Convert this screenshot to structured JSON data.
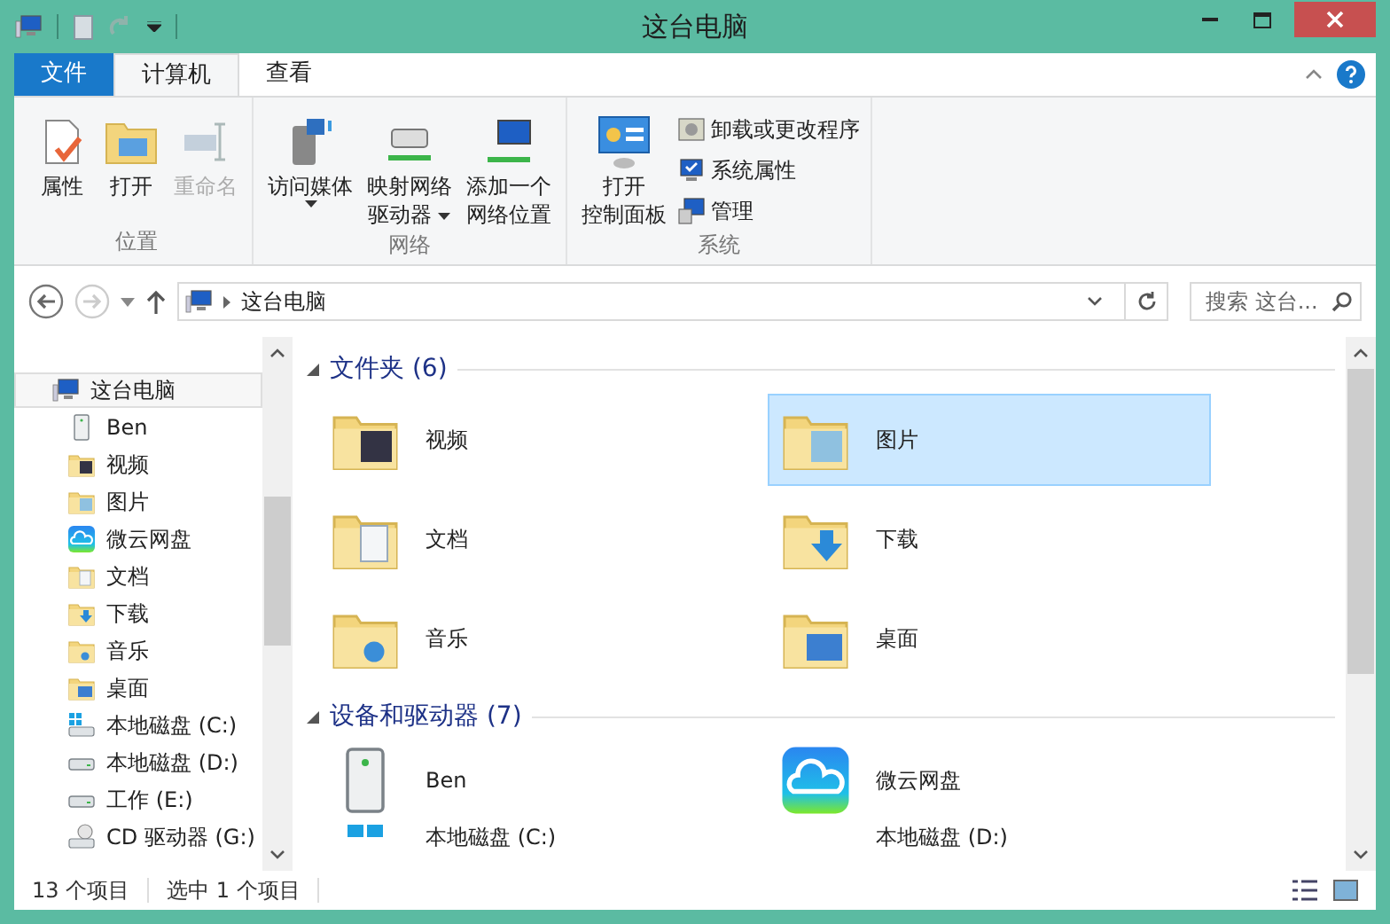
{
  "window": {
    "title": "这台电脑"
  },
  "tabs": [
    {
      "label": "文件",
      "kind": "file",
      "selected": false
    },
    {
      "label": "计算机",
      "kind": "tab",
      "selected": true
    },
    {
      "label": "查看",
      "kind": "tab",
      "selected": false
    }
  ],
  "ribbon": [
    {
      "label": "位置",
      "items": [
        {
          "kind": "large",
          "lines": [
            "属性"
          ],
          "disabled": false,
          "dropdown": false
        },
        {
          "kind": "large",
          "lines": [
            "打开"
          ],
          "disabled": false,
          "dropdown": false
        },
        {
          "kind": "large",
          "lines": [
            "重命名"
          ],
          "disabled": true,
          "dropdown": false
        }
      ]
    },
    {
      "label": "网络",
      "items": [
        {
          "kind": "large",
          "lines": [
            "访问媒体"
          ],
          "disabled": false,
          "dropdown": true
        },
        {
          "kind": "large",
          "lines": [
            "映射网络",
            "驱动器"
          ],
          "disabled": false,
          "dropdown": true
        },
        {
          "kind": "large",
          "lines": [
            "添加一个",
            "网络位置"
          ],
          "disabled": false,
          "dropdown": false
        }
      ]
    },
    {
      "label": "系统",
      "items": [
        {
          "kind": "large",
          "lines": [
            "打开",
            "控制面板"
          ],
          "disabled": false,
          "dropdown": false
        },
        {
          "kind": "small",
          "lines": [
            "卸载或更改程序"
          ],
          "disabled": false
        },
        {
          "kind": "small",
          "lines": [
            "系统属性"
          ],
          "disabled": false
        },
        {
          "kind": "small",
          "lines": [
            "管理"
          ],
          "disabled": false
        }
      ]
    }
  ],
  "address": {
    "path": "这台电脑"
  },
  "search": {
    "placeholder": "搜索 这台..."
  },
  "sidebar": {
    "items": [
      {
        "label": "这台电脑",
        "selected": true,
        "children": [
          {
            "label": "Ben",
            "selected": false
          },
          {
            "label": "视频",
            "selected": false
          },
          {
            "label": "图片",
            "selected": false
          },
          {
            "label": "微云网盘",
            "selected": false
          },
          {
            "label": "文档",
            "selected": false
          },
          {
            "label": "下载",
            "selected": false
          },
          {
            "label": "音乐",
            "selected": false
          },
          {
            "label": "桌面",
            "selected": false
          },
          {
            "label": "本地磁盘 (C:)",
            "selected": false
          },
          {
            "label": "本地磁盘 (D:)",
            "selected": false
          },
          {
            "label": "工作 (E:)",
            "selected": false
          },
          {
            "label": "CD 驱动器 (G:)",
            "selected": false
          }
        ]
      }
    ]
  },
  "groups": [
    {
      "title": "文件夹 (6)",
      "expanded": true,
      "items": [
        {
          "label": "视频",
          "selected": false
        },
        {
          "label": "图片",
          "selected": true
        },
        {
          "label": "文档",
          "selected": false
        },
        {
          "label": "下载",
          "selected": false
        },
        {
          "label": "音乐",
          "selected": false
        },
        {
          "label": "桌面",
          "selected": false
        }
      ]
    },
    {
      "title": "设备和驱动器 (7)",
      "expanded": true,
      "items": [
        {
          "label": "Ben",
          "selected": false
        },
        {
          "label": "微云网盘",
          "selected": false
        },
        {
          "label": "本地磁盘 (C:)",
          "selected": false
        },
        {
          "label": "本地磁盘 (D:)",
          "selected": false
        }
      ]
    }
  ],
  "status_bar": {
    "count": "13 个项目",
    "selection": "选中 1 个项目"
  }
}
